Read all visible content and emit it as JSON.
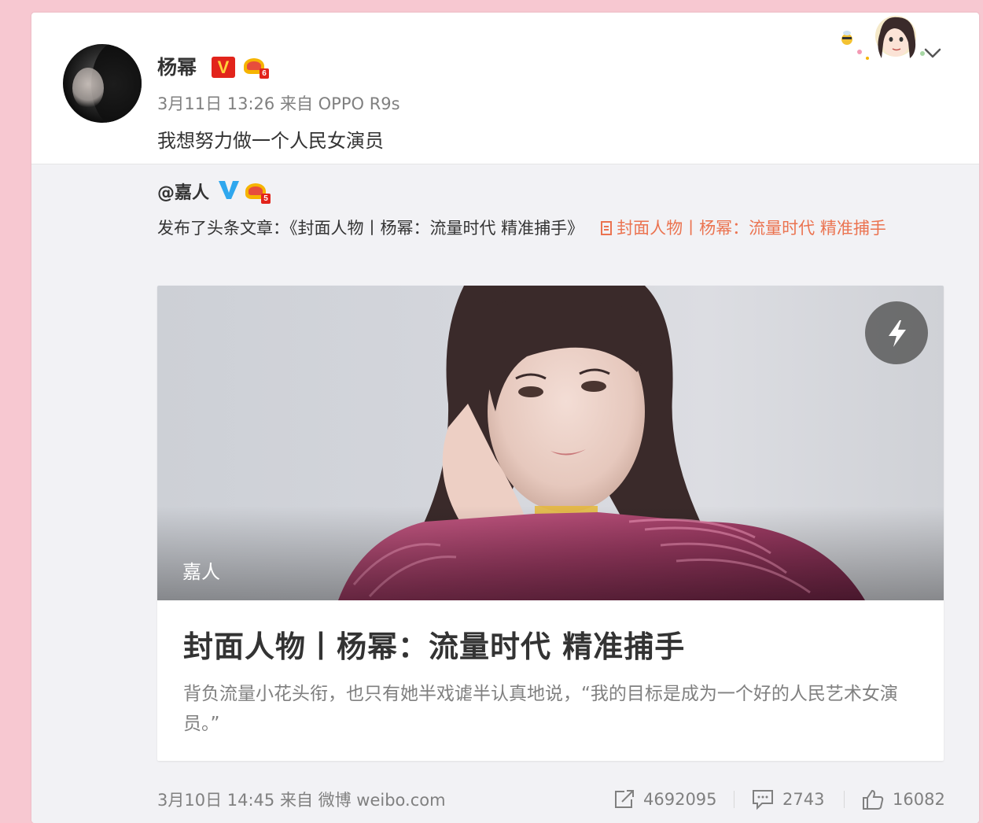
{
  "post": {
    "username": "杨幂",
    "crown_level": "6",
    "meta": "3月11日 13:26 来自 OPPO R9s",
    "text": "我想努力做一个人民女演员"
  },
  "repost": {
    "username": "@嘉人",
    "crown_level": "5",
    "text_prefix": "发布了头条文章：《封面人物丨杨幂：流量时代 精准捕手》",
    "link_text": "封面人物丨杨幂：流量时代 精准捕手",
    "article": {
      "cover_label": "嘉人",
      "title": "封面人物丨杨幂：流量时代 精准捕手",
      "summary": "背负流量小花头衔，也只有她半戏谑半认真地说，“我的目标是成为一个好的人民艺术女演员。”"
    },
    "footer": {
      "meta": "3月10日 14:45 来自 微博 weibo.com",
      "shares": "4692095",
      "comments": "2743",
      "likes": "16082"
    }
  },
  "colors": {
    "page_background": "#f7c8d1",
    "link": "#eb7350",
    "verified_red": "#e2241b",
    "verified_blue": "#2fa7ee"
  },
  "icons": [
    "dropdown-chevron-icon",
    "doc-icon",
    "flash-icon",
    "share-icon",
    "comment-icon",
    "like-icon",
    "crown-icon",
    "verified-v-icon"
  ]
}
